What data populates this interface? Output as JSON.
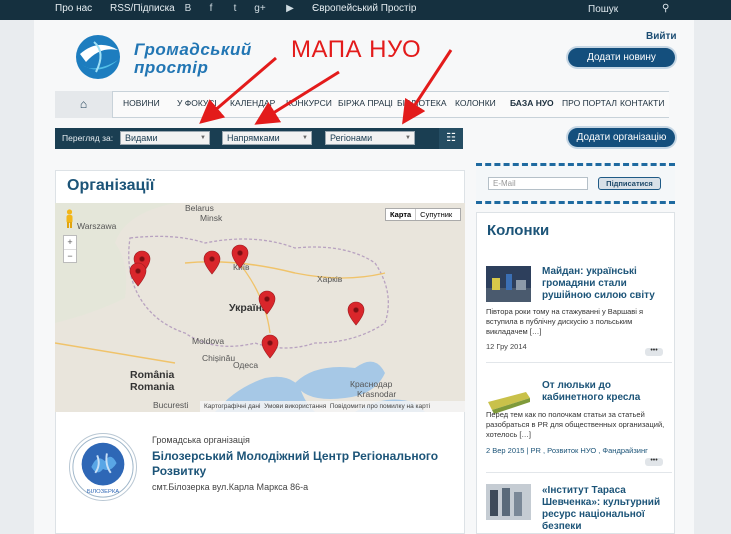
{
  "topbar": {
    "about": "Про нас",
    "rss": "RSS/Підписка",
    "icons": [
      "blogger-icon",
      "facebook-icon",
      "twitter-icon",
      "google-plus-icon",
      "youtube-icon"
    ],
    "icon_glyphs": [
      "B",
      "f",
      "t",
      "g+",
      "▶"
    ],
    "european": "Європейський Простір",
    "search_label": "Пошук"
  },
  "header": {
    "login": "Вийти",
    "add_news": "Додати новину",
    "logo_line1": "Громадський",
    "logo_line2": "простір",
    "annotation": "МАПА НУО"
  },
  "nav": {
    "items": [
      "НОВИНИ",
      "У ФОКУСІ",
      "КАЛЕНДАР",
      "КОНКУРСИ",
      "БІРЖА ПРАЦІ",
      "БІБЛІОТЕКА",
      "КОЛОНКИ",
      "БАЗА НУО",
      "ПРО ПОРТАЛ",
      "КОНТАКТИ"
    ],
    "active": "БАЗА НУО"
  },
  "filter": {
    "label": "Перегляд за:",
    "by_type": "Видами",
    "by_direction": "Напрямками",
    "by_region": "Регіонами",
    "add_org": "Додати організацію"
  },
  "org": {
    "heading": "Організації",
    "map": {
      "type_map": "Карта",
      "type_sat": "Супутник",
      "zoom_in": "+",
      "zoom_out": "−",
      "credits": [
        "Картографічні дані",
        "Умови використання",
        "Повідомити про помилку на карті"
      ],
      "labels": [
        "Belarus",
        "Minsk",
        "Warszawa",
        "Київ",
        "Харків",
        "Україна",
        "Moldova",
        "Chișinău",
        "Одеса",
        "Краснодар",
        "Krasnodar",
        "România",
        "Romania",
        "Bucuresti"
      ]
    },
    "item": {
      "type": "Громадська організація",
      "name_line1": "Білозерський Молодіжний Центр Регіонального",
      "name_line2": "Розвитку",
      "address": "смт.Білозерка вул.Карла Маркса 86-а",
      "logo_text": "БІЛОЗЕРКА"
    }
  },
  "subscribe": {
    "placeholder": "E-Mail",
    "button": "Підписатися"
  },
  "columns": {
    "heading": "Колонки",
    "articles": [
      {
        "title": "Майдан: українські громадяни стали рушійною силою світу",
        "excerpt": "Півтора роки тому на стажуванні у Варшаві я вступила в публічну дискусію з польським викладачем […]",
        "date": "12 Гру 2014"
      },
      {
        "title": "От люльки до кабинетного кресла",
        "excerpt": "Перед тем как по полочкам статьи за статьей разобраться в PR для общественных организаций, хотелось […]",
        "date": "2 Вер 2015 | PR , Розвиток НУО , Фандрайзинг"
      },
      {
        "title": "«Інститут Тараса Шевченка»: культурний ресурс національної безпеки"
      }
    ],
    "more": "•••"
  },
  "colors": {
    "topbar": "#15303f",
    "accent": "#1c5478",
    "button": "#144f7d",
    "annotation": "#e31b1b",
    "pin": "#d9262b"
  }
}
